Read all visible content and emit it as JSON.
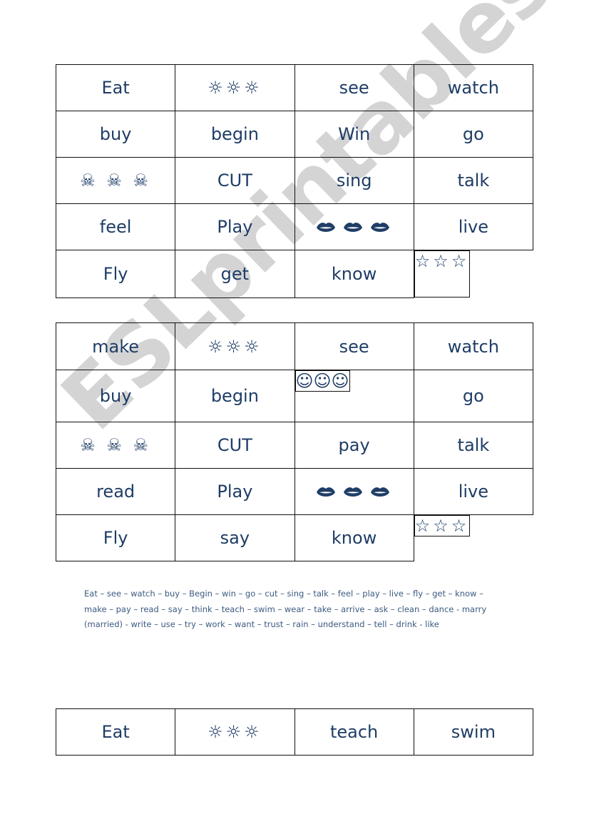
{
  "tables": [
    {
      "rows": [
        [
          "Eat",
          "☼☼☼",
          "see",
          "watch"
        ],
        [
          "buy",
          "begin",
          "Win",
          "go"
        ],
        [
          "☠ ☠ ☠",
          "CUT",
          "sing",
          "talk"
        ],
        [
          "feel",
          "Play",
          "lips-icons",
          "live"
        ],
        [
          "Fly",
          "get",
          "know",
          "☆☆☆"
        ]
      ]
    },
    {
      "rows": [
        [
          "make",
          "☼☼☼",
          "see",
          "watch"
        ],
        [
          "buy",
          "begin",
          "☺☺☺",
          "go"
        ],
        [
          "☠ ☠ ☠",
          "CUT",
          "pay",
          "talk"
        ],
        [
          "read",
          "Play",
          "lips-icons",
          "live"
        ],
        [
          "Fly",
          "say",
          "know",
          "☆☆☆"
        ]
      ]
    },
    {
      "rows": [
        [
          "Eat",
          "☼☼☼",
          "teach",
          "swim"
        ]
      ]
    }
  ],
  "symbols": {
    "sun": "☼☼☼",
    "skull": "☠ ☠ ☠",
    "star": "☆☆☆",
    "smile": "☺☺☺"
  },
  "wordlist": "Eat – see – watch – buy – Begin – win – go – cut – sing – talk – feel – play – live – fly – get – know – make – pay – read – say – think – teach – swim – wear – take – arrive – ask – clean – dance - marry (married) -  write – use – try – work – want – trust – rain – understand – tell – drink - like",
  "watermark": "ESLprintables.com"
}
